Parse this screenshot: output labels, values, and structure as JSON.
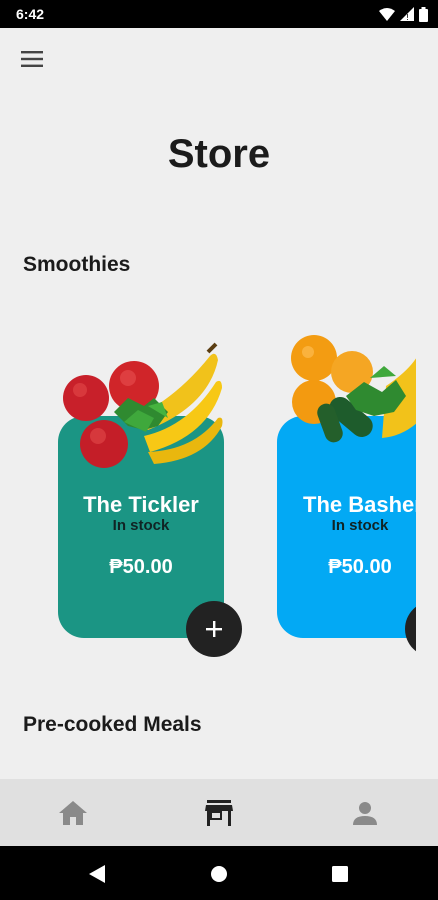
{
  "status_bar": {
    "time": "6:42"
  },
  "header": {
    "title": "Store"
  },
  "sections": {
    "smoothies": "Smoothies",
    "meals": "Pre-cooked Meals"
  },
  "products": [
    {
      "name": "The Tickler",
      "stock": "In stock",
      "price": "₱50.00",
      "color": "#1b9584"
    },
    {
      "name": "The Basher",
      "stock": "In stock",
      "price": "₱50.00",
      "color": "#03a9f4"
    }
  ],
  "nav": {
    "items": [
      "home-icon",
      "store-icon",
      "person-icon"
    ],
    "active": "store"
  }
}
